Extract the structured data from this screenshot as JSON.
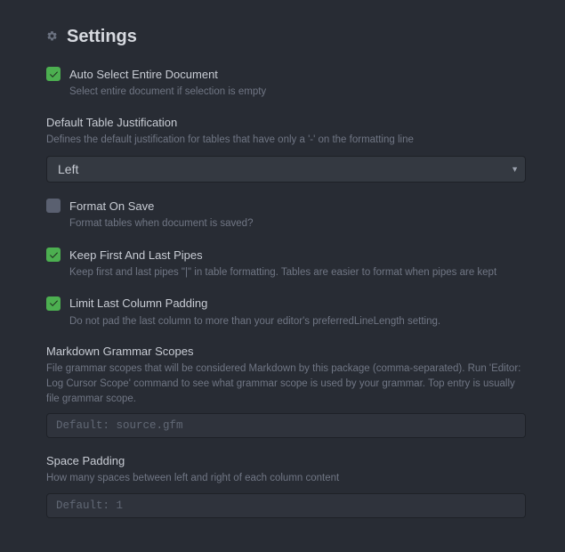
{
  "header": {
    "title": "Settings"
  },
  "settings": {
    "autoSelect": {
      "label": "Auto Select Entire Document",
      "desc": "Select entire document if selection is empty",
      "checked": true
    },
    "defaultJustification": {
      "label": "Default Table Justification",
      "desc": "Defines the default justification for tables that have only a '-' on the formatting line",
      "value": "Left"
    },
    "formatOnSave": {
      "label": "Format On Save",
      "desc": "Format tables when document is saved?",
      "checked": false
    },
    "keepPipes": {
      "label": "Keep First And Last Pipes",
      "desc": "Keep first and last pipes \"|\" in table formatting. Tables are easier to format when pipes are kept",
      "checked": true
    },
    "limitPadding": {
      "label": "Limit Last Column Padding",
      "desc": "Do not pad the last column to more than your editor's preferredLineLength setting.",
      "checked": true
    },
    "grammarScopes": {
      "label": "Markdown Grammar Scopes",
      "desc": "File grammar scopes that will be considered Markdown by this package (comma-separated). Run 'Editor: Log Cursor Scope' command to see what grammar scope is used by your grammar. Top entry is usually file grammar scope.",
      "placeholder": "Default: source.gfm",
      "value": ""
    },
    "spacePadding": {
      "label": "Space Padding",
      "desc": "How many spaces between left and right of each column content",
      "placeholder": "Default: 1",
      "value": ""
    }
  }
}
